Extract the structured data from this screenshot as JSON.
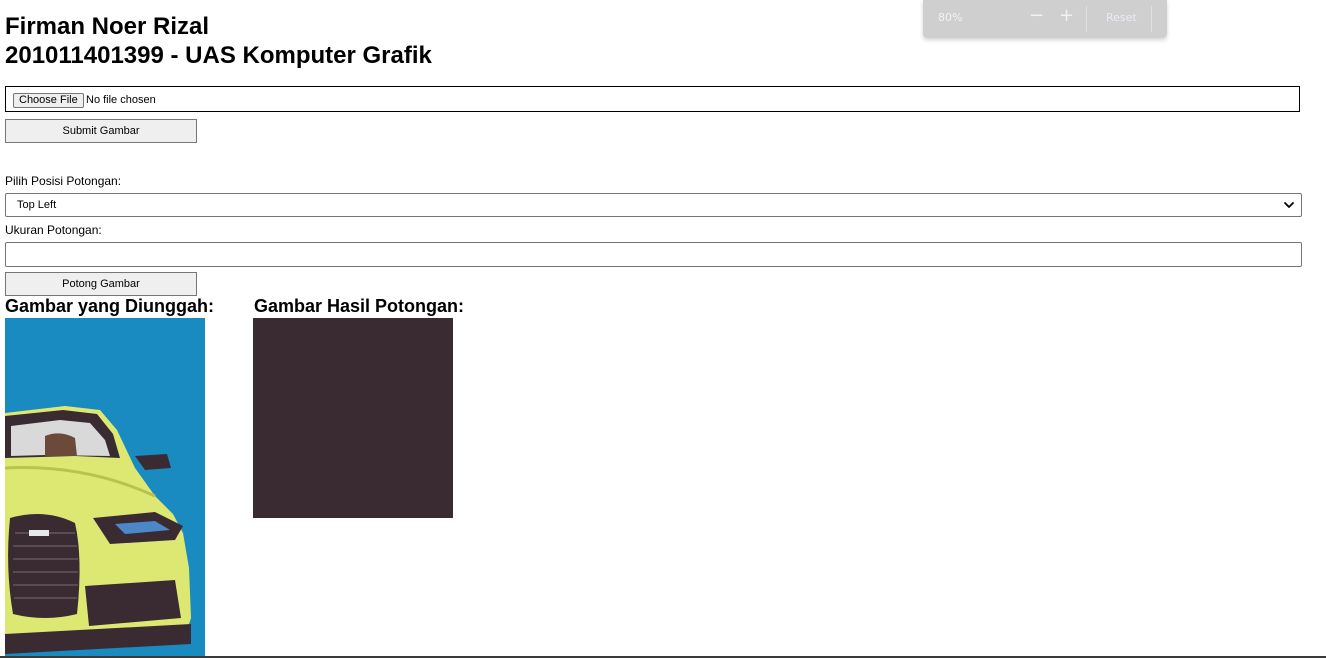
{
  "header": {
    "name": "Firman Noer Rizal",
    "subtitle": "201011401399 - UAS Komputer Grafik"
  },
  "zoom_popup": {
    "level": "80%",
    "minus": "−",
    "plus": "+",
    "reset_label": "Reset"
  },
  "upload_form": {
    "choose_file_label": "Choose File",
    "file_status": "No file chosen",
    "submit_label": "Submit Gambar"
  },
  "crop_form": {
    "position_label": "Pilih Posisi Potongan:",
    "position_selected": "Top Left",
    "size_label": "Ukuran Potongan:",
    "size_value": "",
    "crop_button_label": "Potong Gambar"
  },
  "results": {
    "uploaded_heading": "Gambar yang Diunggah:",
    "cropped_heading": "Gambar Hasil Potongan:",
    "cropped_fill_color": "#3a2b33",
    "uploaded_bg_color": "#1a8bc0",
    "car_color": "#dde873"
  },
  "icons": {
    "select_chevron": "chevron-down-icon"
  }
}
